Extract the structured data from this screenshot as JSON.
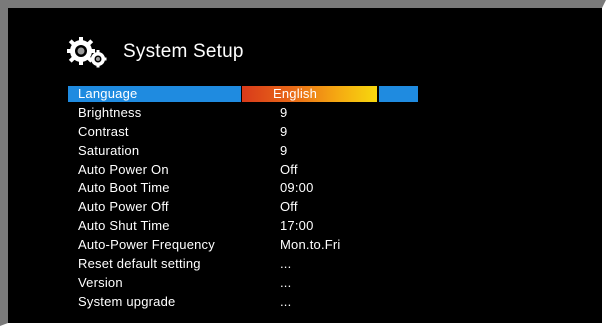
{
  "header": {
    "title": "System Setup",
    "icon": "gears-icon"
  },
  "colors": {
    "highlight_blue": "#1f8be0",
    "gradient_start": "#d83a1a",
    "gradient_end": "#f7d80e"
  },
  "menu": {
    "selected_index": 0,
    "items": [
      {
        "label": "Language",
        "value": "English"
      },
      {
        "label": "Brightness",
        "value": "9"
      },
      {
        "label": "Contrast",
        "value": "9"
      },
      {
        "label": "Saturation",
        "value": "9"
      },
      {
        "label": "Auto Power On",
        "value": "Off"
      },
      {
        "label": "Auto Boot Time",
        "value": "09:00"
      },
      {
        "label": "Auto Power Off",
        "value": "Off"
      },
      {
        "label": "Auto Shut Time",
        "value": "17:00"
      },
      {
        "label": "Auto-Power Frequency",
        "value": "Mon.to.Fri"
      },
      {
        "label": "Reset default setting",
        "value": "..."
      },
      {
        "label": "Version",
        "value": "..."
      },
      {
        "label": "System upgrade",
        "value": "..."
      }
    ]
  }
}
